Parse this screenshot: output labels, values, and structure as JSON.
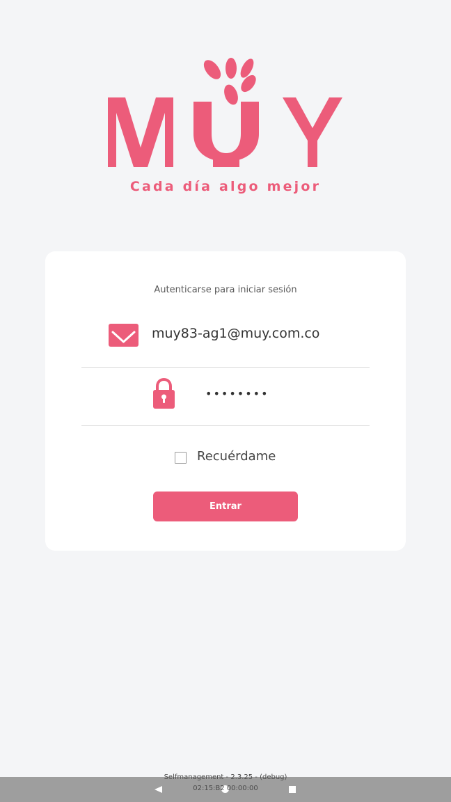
{
  "brand": {
    "logo_text": "MUY",
    "tagline": "Cada día algo mejor",
    "accent_color": "#ec5c7a"
  },
  "login": {
    "title": "Autenticarse para iniciar sesión",
    "email_icon": "mail-icon",
    "email_value": "muy83-ag1@muy.com.co",
    "password_icon": "lock-icon",
    "password_value": "••••••••",
    "remember_label": "Recuérdame",
    "remember_checked": false,
    "submit_label": "Entrar"
  },
  "footer": {
    "build_info": "Selfmanagement - 2.3.25 - (debug)",
    "build_time": "02:15:B2 00:00:00"
  },
  "navbar": {
    "back_icon": "back-triangle-icon",
    "home_icon": "home-circle-icon",
    "recent_icon": "recent-square-icon"
  }
}
